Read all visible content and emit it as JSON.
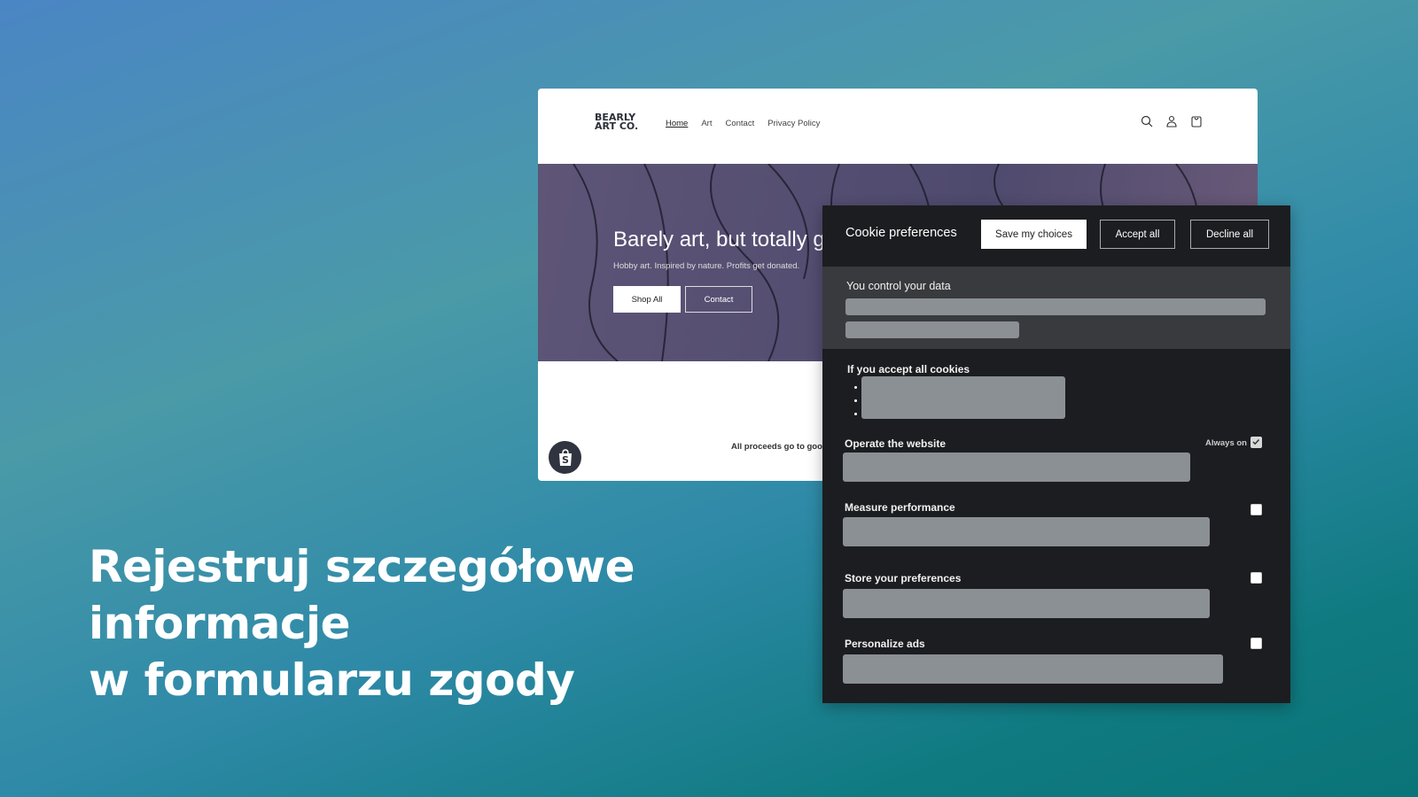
{
  "headline": [
    "Rejestruj szczegółowe",
    "informacje",
    "w formularzu zgody"
  ],
  "site": {
    "logo": [
      "BEARLY",
      "ART CO."
    ],
    "nav": [
      "Home",
      "Art",
      "Contact",
      "Privacy Policy"
    ],
    "icons": [
      "search-icon",
      "account-icon",
      "cart-icon"
    ],
    "hero": {
      "title": "Barely art, but totally g",
      "subtitle": "Hobby art. Inspired by nature. Profits get donated.",
      "shop_all": "Shop All",
      "contact": "Contact"
    },
    "footer_text": "All proceeds go to goo"
  },
  "cookie": {
    "title": "Cookie preferences",
    "save": "Save my choices",
    "accept": "Accept all",
    "decline": "Decline all",
    "intro_title": "You control your data",
    "accept_title": "If you accept all cookies",
    "categories": [
      {
        "label": "Operate the website",
        "status": "Always on",
        "checked": true
      },
      {
        "label": "Measure performance",
        "checked": false
      },
      {
        "label": "Store your preferences",
        "checked": false
      },
      {
        "label": "Personalize ads",
        "checked": false
      }
    ]
  },
  "colors": {
    "panel": "#1c1d20",
    "intro": "#393a3d",
    "placeholder": "#8b9095"
  }
}
